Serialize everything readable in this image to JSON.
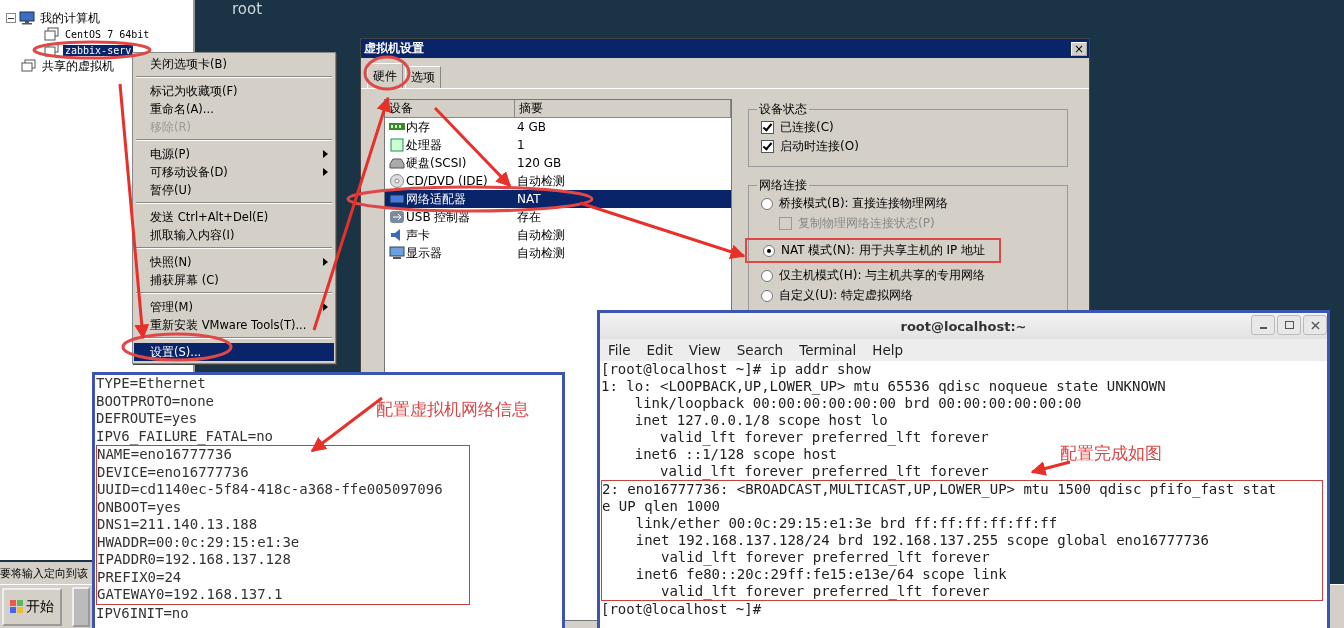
{
  "desktop": {
    "title": "root"
  },
  "library": {
    "items": [
      {
        "label": "我的计算机",
        "children": [
          {
            "label": "CentOS 7 64bit",
            "selected": false
          },
          {
            "label": "zabbix-serv",
            "selected": true
          }
        ]
      },
      {
        "label": "共享的虚拟机"
      }
    ]
  },
  "context_menu": {
    "groups": [
      [
        {
          "label": "关闭选项卡(B)",
          "disabled": false,
          "submenu": false,
          "selected": false
        }
      ],
      [
        {
          "label": "标记为收藏项(F)",
          "disabled": false,
          "submenu": false,
          "selected": false
        },
        {
          "label": "重命名(A)...",
          "disabled": false,
          "submenu": false,
          "selected": false
        },
        {
          "label": "移除(R)",
          "disabled": true,
          "submenu": false,
          "selected": false
        }
      ],
      [
        {
          "label": "电源(P)",
          "disabled": false,
          "submenu": true,
          "selected": false
        },
        {
          "label": "可移动设备(D)",
          "disabled": false,
          "submenu": true,
          "selected": false
        },
        {
          "label": "暂停(U)",
          "disabled": false,
          "submenu": false,
          "selected": false
        }
      ],
      [
        {
          "label": "发送 Ctrl+Alt+Del(E)",
          "disabled": false,
          "submenu": false,
          "selected": false
        },
        {
          "label": "抓取输入内容(I)",
          "disabled": false,
          "submenu": false,
          "selected": false
        }
      ],
      [
        {
          "label": "快照(N)",
          "disabled": false,
          "submenu": true,
          "selected": false
        },
        {
          "label": "捕获屏幕 (C)",
          "disabled": false,
          "submenu": false,
          "selected": false
        }
      ],
      [
        {
          "label": "管理(M)",
          "disabled": false,
          "submenu": true,
          "selected": false
        },
        {
          "label": "重新安装 VMware Tools(T)...",
          "disabled": false,
          "submenu": false,
          "selected": false
        }
      ],
      [
        {
          "label": "设置(S)...",
          "disabled": false,
          "submenu": false,
          "selected": true
        }
      ]
    ]
  },
  "settings_dialog": {
    "title": "虚拟机设置",
    "close": "×",
    "tabs": [
      {
        "label": "硬件",
        "selected": true
      },
      {
        "label": "选项",
        "selected": false
      }
    ],
    "device_table": {
      "columns": [
        "设备",
        "摘要"
      ],
      "rows": [
        {
          "kind": "memory",
          "device": "内存",
          "summary": "4 GB",
          "selected": false
        },
        {
          "kind": "cpu",
          "device": "处理器",
          "summary": "1",
          "selected": false
        },
        {
          "kind": "disk",
          "device": "硬盘(SCSI)",
          "summary": "120 GB",
          "selected": false
        },
        {
          "kind": "cd",
          "device": "CD/DVD (IDE)",
          "summary": "自动检测",
          "selected": false
        },
        {
          "kind": "network",
          "device": "网络适配器",
          "summary": "NAT",
          "selected": true
        },
        {
          "kind": "usb",
          "device": "USB 控制器",
          "summary": "存在",
          "selected": false
        },
        {
          "kind": "sound",
          "device": "声卡",
          "summary": "自动检测",
          "selected": false
        },
        {
          "kind": "display",
          "device": "显示器",
          "summary": "自动检测",
          "selected": false
        }
      ]
    },
    "device_status": {
      "title": "设备状态",
      "options": [
        {
          "label": "已连接(C)",
          "checked": true
        },
        {
          "label": "启动时连接(O)",
          "checked": true
        }
      ]
    },
    "network_connection": {
      "title": "网络连接",
      "options": [
        {
          "kind": "radio",
          "label": "桥接模式(B): 直接连接物理网络",
          "selected": false
        },
        {
          "kind": "checkbox",
          "label": "复制物理网络连接状态(P)",
          "checked": false,
          "disabled": true
        },
        {
          "kind": "radio",
          "label": "NAT 模式(N): 用于共享主机的 IP 地址",
          "selected": true
        },
        {
          "kind": "radio",
          "label": "仅主机模式(H): 与主机共享的专用网络",
          "selected": false
        },
        {
          "kind": "radio",
          "label": "自定义(U): 特定虚拟网络",
          "selected": false
        }
      ]
    }
  },
  "config_file": {
    "lines_before": [
      "TYPE=Ethernet",
      "BOOTPROTO=none",
      "DEFROUTE=yes",
      "IPV6_FAILURE_FATAL=no"
    ],
    "highlighted_lines": [
      "NAME=eno16777736",
      "DEVICE=eno16777736",
      "UUID=cd1140ec-5f84-418c-a368-ffe005097096",
      "ONBOOT=yes",
      "DNS1=211.140.13.188",
      "HWADDR=00:0c:29:15:e1:3e",
      "IPADDR0=192.168.137.128",
      "PREFIX0=24",
      "GATEWAY0=192.168.137.1"
    ],
    "lines_after": [
      "IPV6INIT=no"
    ],
    "note": "配置虚拟机网络信息"
  },
  "terminal": {
    "title": "root@localhost:~",
    "menu": [
      "File",
      "Edit",
      "View",
      "Search",
      "Terminal",
      "Help"
    ],
    "lines_before": [
      "[root@localhost ~]# ip addr show",
      "1: lo: <LOOPBACK,UP,LOWER_UP> mtu 65536 qdisc noqueue state UNKNOWN",
      "    link/loopback 00:00:00:00:00:00 brd 00:00:00:00:00:00",
      "    inet 127.0.0.1/8 scope host lo",
      "       valid_lft forever preferred_lft forever",
      "    inet6 ::1/128 scope host",
      "       valid_lft forever preferred_lft forever"
    ],
    "highlighted_lines": [
      "2: eno16777736: <BROADCAST,MULTICAST,UP,LOWER_UP> mtu 1500 qdisc pfifo_fast stat",
      "e UP qlen 1000",
      "    link/ether 00:0c:29:15:e1:3e brd ff:ff:ff:ff:ff:ff",
      "    inet 192.168.137.128/24 brd 192.168.137.255 scope global eno16777736",
      "       valid_lft forever preferred_lft forever",
      "    inet6 fe80::20c:29ff:fe15:e13e/64 scope link",
      "       valid_lft forever preferred_lft forever"
    ],
    "lines_after": [
      "[root@localhost ~]#"
    ],
    "note": "配置完成如图"
  },
  "status_bar": {
    "text": "要将输入定向到该"
  },
  "taskbar": {
    "start": "开始"
  }
}
